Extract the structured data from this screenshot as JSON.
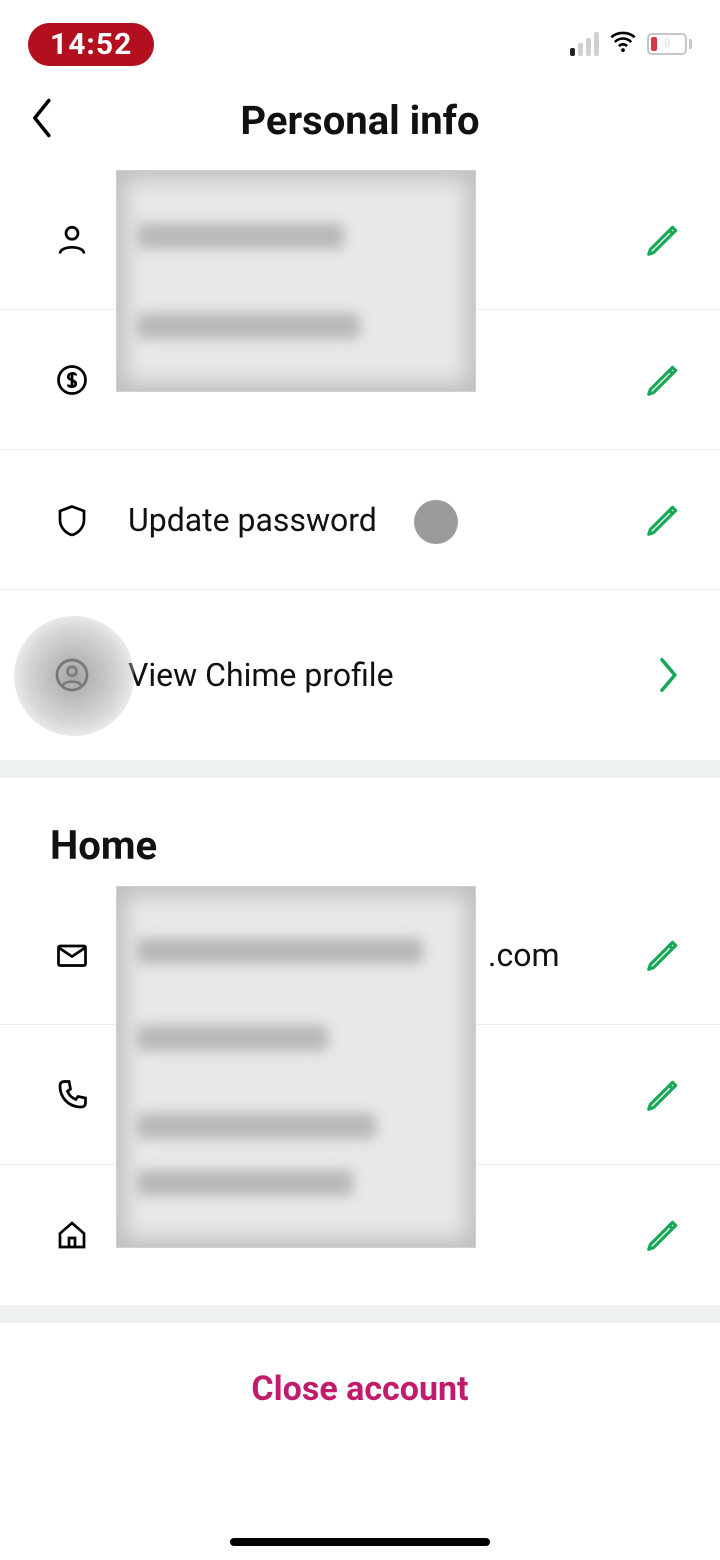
{
  "status": {
    "time": "14:52",
    "battery_text": "1"
  },
  "header": {
    "title": "Personal info"
  },
  "rows": {
    "password_label": "Update password",
    "profile_label": "View Chime profile"
  },
  "sections": {
    "home_title": "Home",
    "email_visible_suffix": ".com"
  },
  "actions": {
    "close_account": "Close account"
  },
  "icons": {
    "back": "chevron-left",
    "person": "person",
    "dollar": "dollar-circle",
    "shield": "shield",
    "profile": "profile-circle",
    "mail": "mail",
    "phone": "phone",
    "home": "home",
    "edit": "pencil",
    "forward": "chevron-right"
  },
  "colors": {
    "accent_green": "#18a858",
    "time_pill": "#b20f1f",
    "danger": "#c01c6b"
  }
}
